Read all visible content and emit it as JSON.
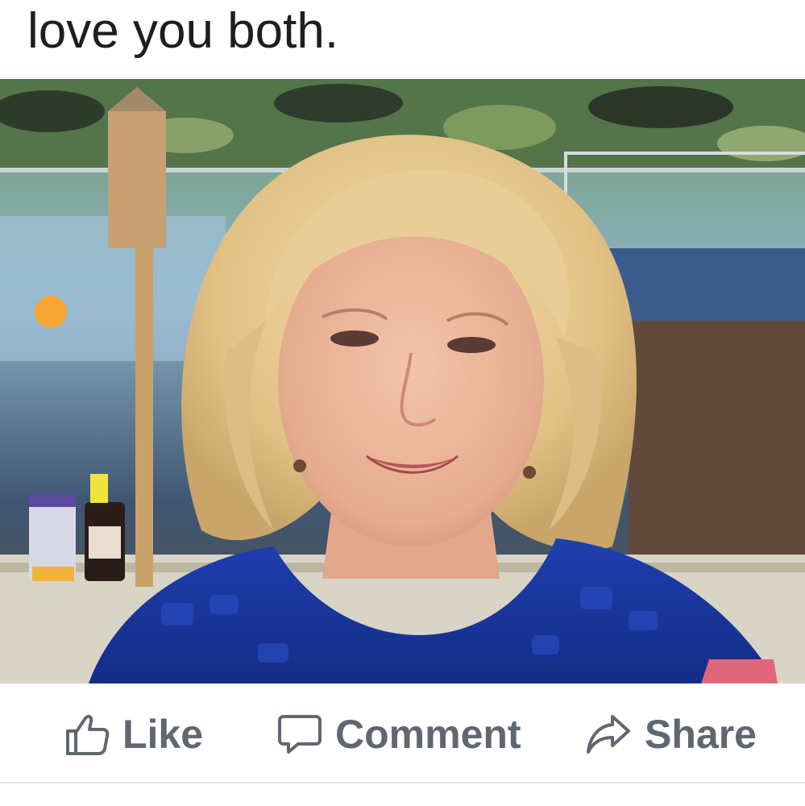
{
  "post": {
    "text": "love you both."
  },
  "actions": {
    "like_label": "Like",
    "comment_label": "Comment",
    "share_label": "Share"
  },
  "icons": {
    "like": "thumbs-up-icon",
    "comment": "speech-bubble-icon",
    "share": "share-arrow-icon"
  },
  "colors": {
    "action_text": "#606770",
    "post_text": "#1c1e21",
    "divider": "#e4e6eb"
  }
}
